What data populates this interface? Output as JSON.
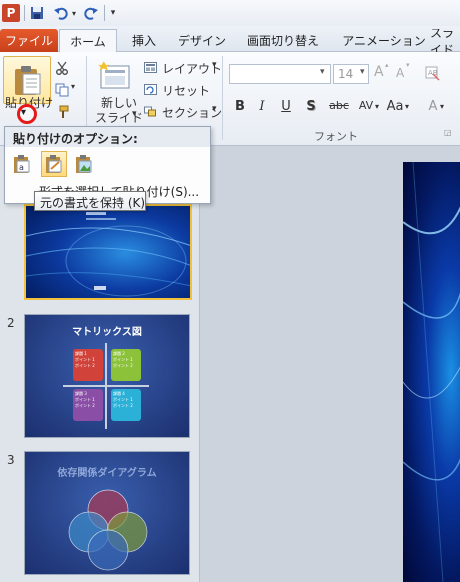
{
  "qat": {
    "logo": "P",
    "items": [
      "save-icon",
      "undo-icon",
      "redo-icon"
    ]
  },
  "tabs": {
    "file": "ファイル",
    "home": "ホーム",
    "insert": "挿入",
    "design": "デザイン",
    "transitions": "画面切り替え",
    "animations": "アニメーション",
    "slideshow": "スライド"
  },
  "ribbon": {
    "paste_label": "貼り付け",
    "new_slide_line1": "新しい",
    "new_slide_line2": "スライド",
    "layout": "レイアウト",
    "reset": "リセット",
    "section": "セクション",
    "font_size": "14",
    "font_group_label": "フォント",
    "bold": "B",
    "italic": "I",
    "underline": "U",
    "strike": "S",
    "strike2": "abc",
    "spacing": "AV",
    "case": "Aa",
    "color": "A",
    "grow": "A",
    "shrink": "A"
  },
  "paste_menu": {
    "title": "貼り付けのオプション:",
    "special": "形式を選択して貼り付け(S)...",
    "options": [
      "use-destination-theme-icon",
      "keep-source-formatting-icon",
      "picture-icon"
    ]
  },
  "tooltip": "元の書式を保持 (K)",
  "slides": [
    {
      "num": "1"
    },
    {
      "num": "2",
      "title": "マトリックス図",
      "cells": [
        {
          "title": "課題 1",
          "bullets": [
            "ポイント 1",
            "ポイント 2"
          ],
          "color": "#d0423a"
        },
        {
          "title": "課題 2",
          "bullets": [
            "ポイント 1",
            "ポイント 2"
          ],
          "color": "#8cc23a"
        },
        {
          "title": "課題 3",
          "bullets": [
            "ポイント 1",
            "ポイント 2"
          ],
          "color": "#8a4ea6"
        },
        {
          "title": "課題 4",
          "bullets": [
            "ポイント 1",
            "ポイント 2"
          ],
          "color": "#2bb0d8"
        }
      ]
    },
    {
      "num": "3",
      "title": "依存関係ダイアグラム"
    }
  ],
  "colors": {
    "file_tab": "#d24a22",
    "slide_bg": "#1e3e8c",
    "accent_yellow": "#ffd97a",
    "highlight_red": "#e61919"
  }
}
